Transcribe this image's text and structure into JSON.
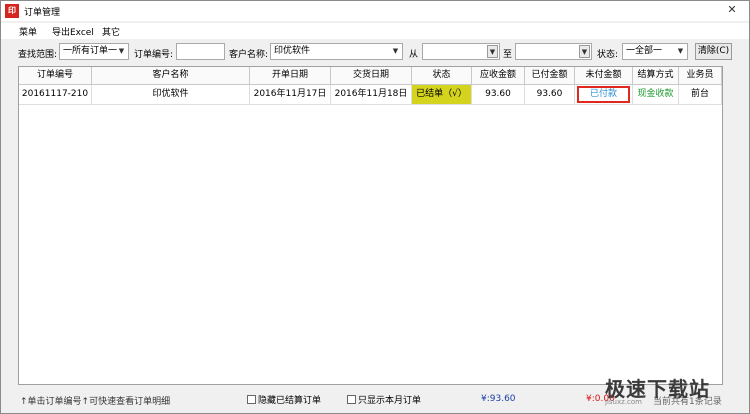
{
  "window": {
    "title": "订单管理",
    "app_icon_text": "印",
    "close_glyph": "✕"
  },
  "menu": [
    "菜单",
    "导出Excel",
    "其它"
  ],
  "filters": {
    "scope_label": "查找范围:",
    "scope_value": "一所有订单一",
    "order_no_label": "订单编号:",
    "order_no_value": "",
    "customer_label": "客户名称:",
    "customer_value": "印优软件",
    "from_label": "从",
    "from_value": "",
    "to_label": "至",
    "to_value": "",
    "status_label": "状态:",
    "status_value": "一全部一",
    "clear_button": "清除(C)"
  },
  "table": {
    "headers": [
      "订单编号",
      "客户名称",
      "开单日期",
      "交货日期",
      "状态",
      "应收金额",
      "已付金额",
      "未付金额",
      "结算方式",
      "业务员"
    ],
    "rows": [
      [
        "20161117-210",
        "印优软件",
        "2016年11月17日",
        "2016年11月18日",
        "已结单（√）",
        "93.60",
        "93.60",
        "已付款",
        "现金收款",
        "前台"
      ]
    ]
  },
  "statusbar": {
    "hint": "↑单击订单编号↑可快速查看订单明细",
    "hide_settled": "隐藏已结算订单",
    "this_month_only": "只显示本月订单",
    "total_receivable": "¥:93.60",
    "total_unpaid": "¥:0.00",
    "count": "当前共有1条记录"
  },
  "watermark": {
    "text": "极速下载站",
    "sub": "jisuxz.com"
  },
  "colors": {
    "status_cell": "#d4d41e",
    "unpaid_text": "#2f8fd6",
    "highlight_border": "#e0281f",
    "settle_text": "#1f9a2f",
    "app_icon": "#d6241e"
  },
  "icons": {
    "dropdown": "chevron-down-icon",
    "close": "close-icon"
  }
}
